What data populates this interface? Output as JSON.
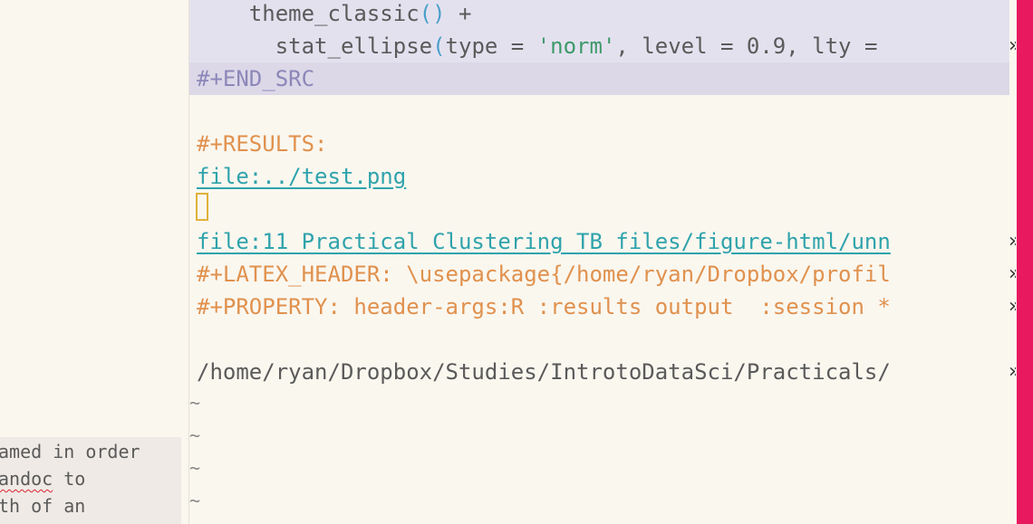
{
  "popup": {
    "lines": [
      {
        "pre": "amed in order",
        "err": "",
        "post": ""
      },
      {
        "pre": "",
        "err": "andoc",
        "post": " to"
      },
      {
        "pre": "th of an",
        "err": "",
        "post": ""
      }
    ]
  },
  "editor": {
    "line1": {
      "indent": "    ",
      "fn": "theme_classic",
      "open": "(",
      "close": ")",
      "rest": " +"
    },
    "line2": {
      "indent": "      ",
      "fn": "stat_ellipse",
      "open": "(",
      "args1": "type = ",
      "str": "'norm'",
      "args2": ", level = 0.9, lty = "
    },
    "end_src": "#+END_SRC",
    "results_label": "#+RESULTS:",
    "results_link": "file:../test.png",
    "file_link2": "file:11_Practical_Clustering_TB_files/figure-html/unn",
    "latex_header": "#+LATEX_HEADER: \\usepackage{/home/ryan/Dropbox/profil",
    "property": "#+PROPERTY: header-args:R :results output  :session *",
    "path_line": "/home/ryan/Dropbox/Studies/IntrotoDataSci/Practicals/",
    "tilde": "~",
    "wrap_char": "»"
  },
  "colors": {
    "background": "#faf7ef",
    "src_block": "#e4e1ef",
    "keyword": "#e0914e",
    "link": "#2fa3ac",
    "string": "#3e9a6a",
    "accent": "#e8195f",
    "cursor": "#e0b13a"
  }
}
